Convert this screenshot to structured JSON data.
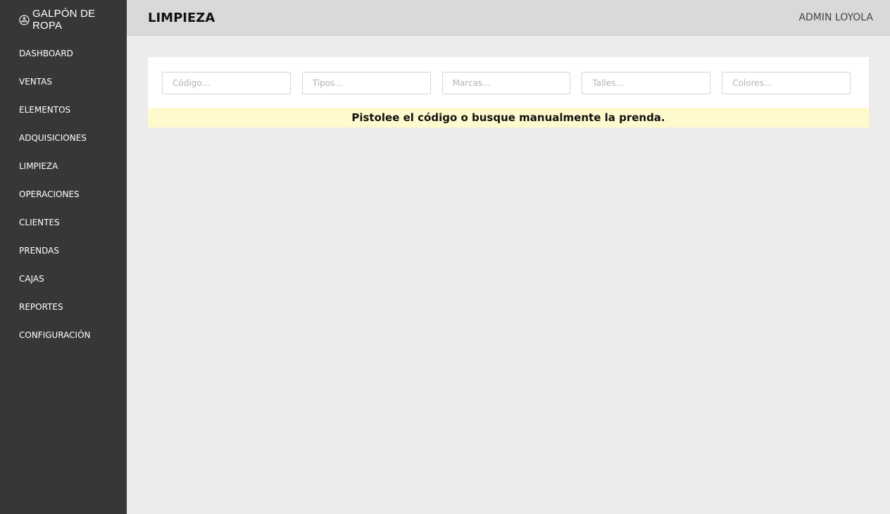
{
  "brand": {
    "name": "GALPÓN DE ROPA",
    "icon": "hanger-icon"
  },
  "sidebar": {
    "items": [
      {
        "label": "DASHBOARD"
      },
      {
        "label": "VENTAS"
      },
      {
        "label": "ELEMENTOS"
      },
      {
        "label": "ADQUISICIONES"
      },
      {
        "label": "LIMPIEZA"
      },
      {
        "label": "OPERACIONES"
      },
      {
        "label": "CLIENTES"
      },
      {
        "label": "PRENDAS"
      },
      {
        "label": "CAJAS"
      },
      {
        "label": "REPORTES"
      },
      {
        "label": "CONFIGURACIÓN"
      }
    ]
  },
  "header": {
    "title": "LIMPIEZA",
    "user": "ADMIN LOYOLA"
  },
  "filters": {
    "codigo": {
      "placeholder": "Código...",
      "value": ""
    },
    "tipos": {
      "placeholder": "Tipos...",
      "value": ""
    },
    "marcas": {
      "placeholder": "Marcas...",
      "value": ""
    },
    "talles": {
      "placeholder": "Talles...",
      "value": ""
    },
    "colores": {
      "placeholder": "Colores...",
      "value": ""
    }
  },
  "notice": {
    "text": "Pistolee el código o busque manualmente la prenda."
  },
  "colors": {
    "sidebar_bg": "#373737",
    "topbar_bg": "#d9d9d9",
    "page_bg": "#ececec",
    "notice_bg": "#fffacd"
  }
}
